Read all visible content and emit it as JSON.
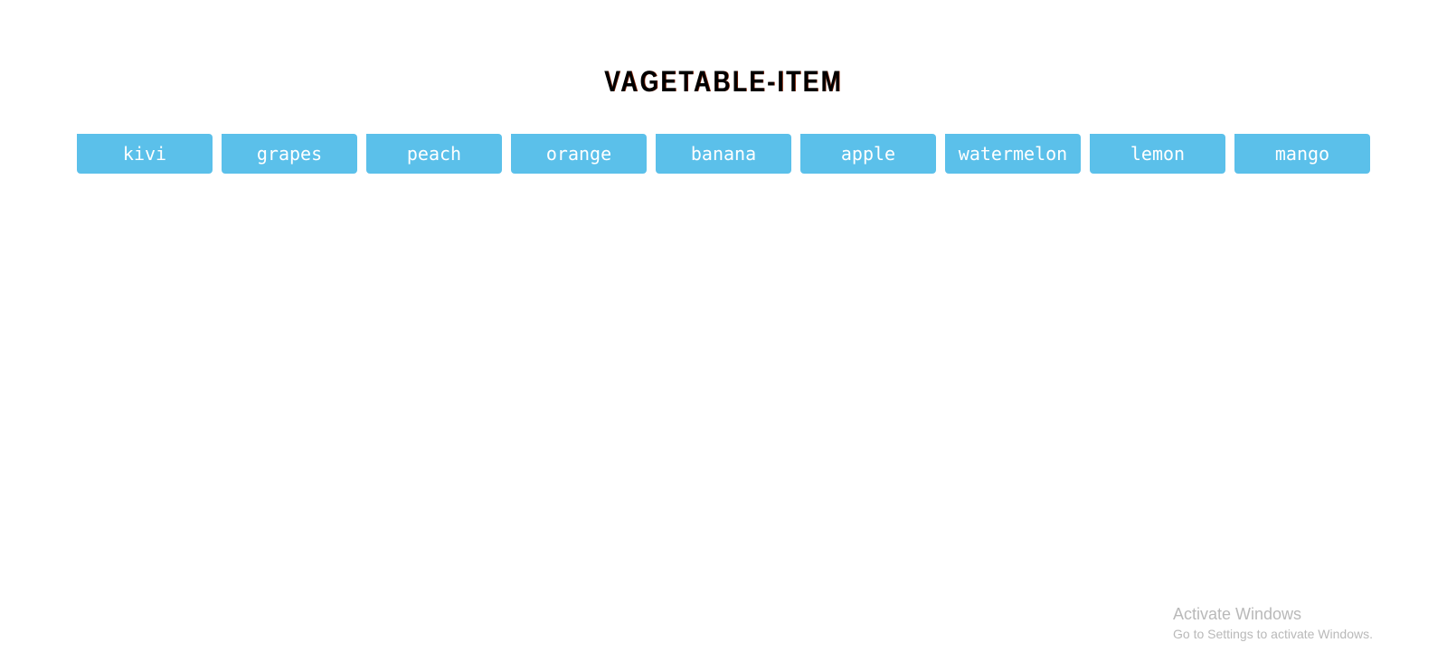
{
  "title": "VAGETABLE-ITEM",
  "items": [
    {
      "label": "kivi"
    },
    {
      "label": "grapes"
    },
    {
      "label": "peach"
    },
    {
      "label": "orange"
    },
    {
      "label": "banana"
    },
    {
      "label": "apple"
    },
    {
      "label": "watermelon"
    },
    {
      "label": "lemon"
    },
    {
      "label": "mango"
    }
  ],
  "watermark": {
    "line1": "Activate Windows",
    "line2": "Go to Settings to activate Windows."
  },
  "colors": {
    "button_bg": "#5bc0ea",
    "button_text": "#ffffff",
    "title_text": "#000000"
  }
}
